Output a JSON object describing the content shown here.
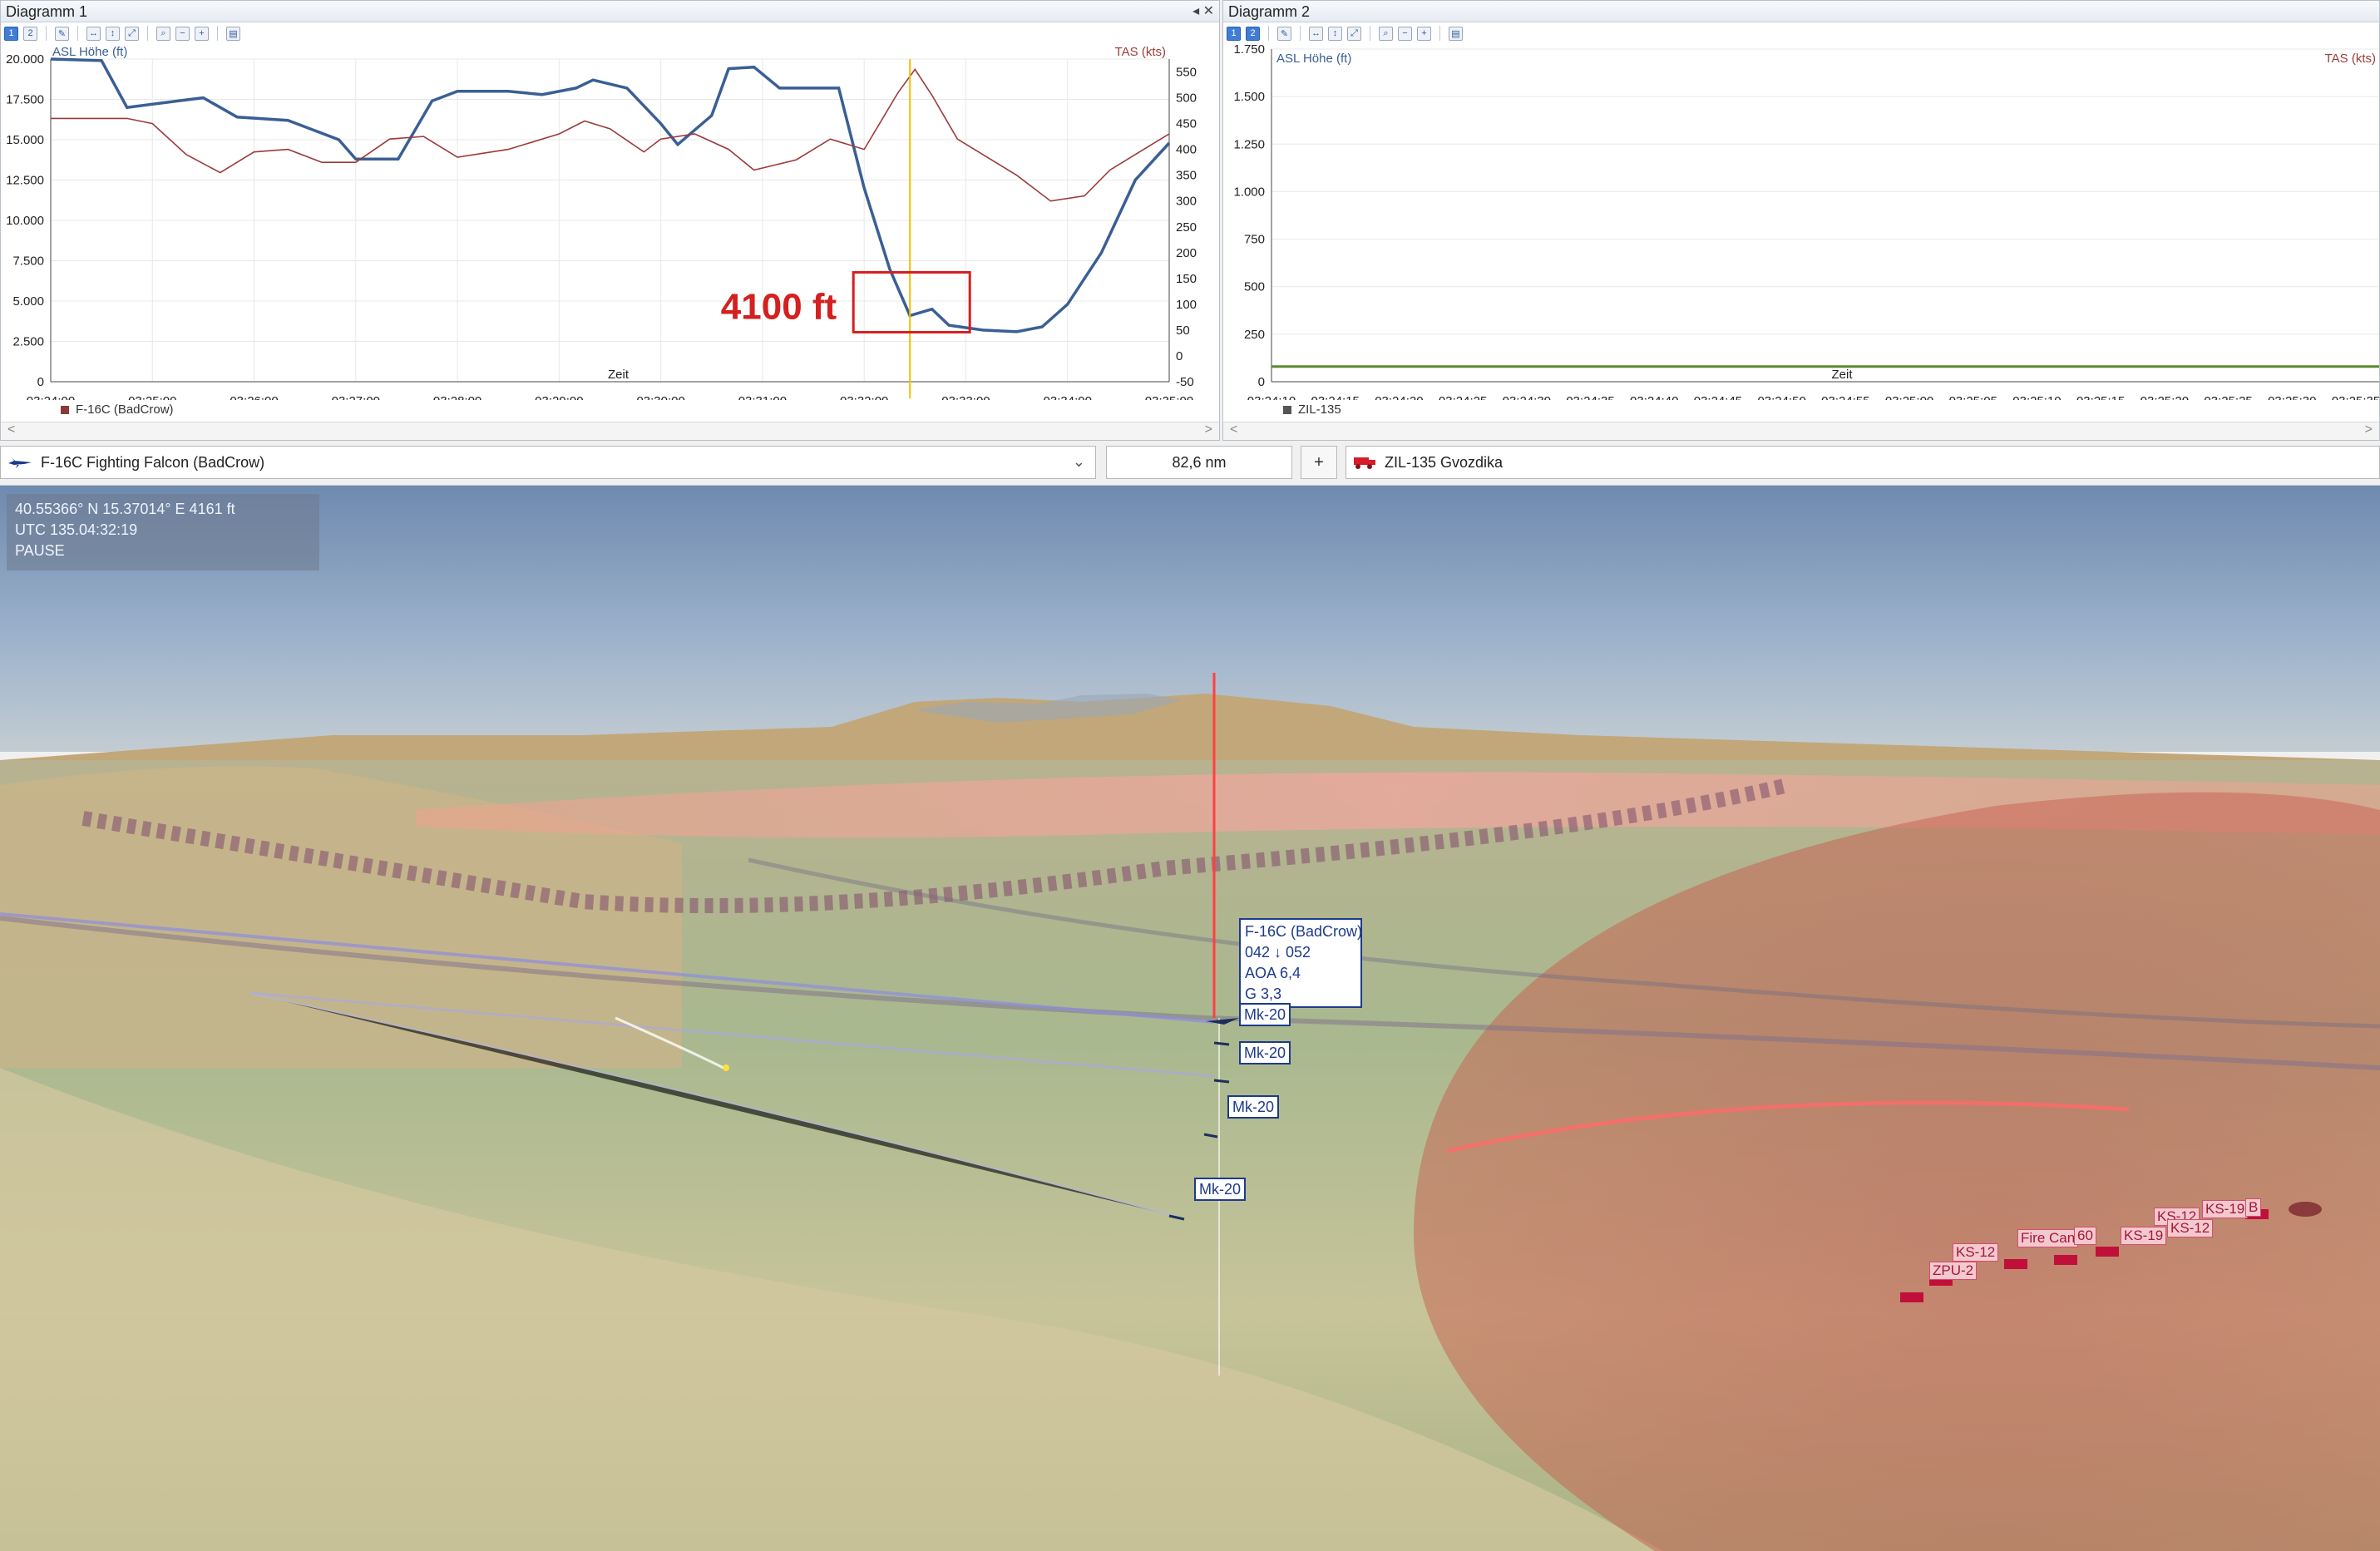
{
  "diagram1": {
    "title": "Diagramm 1",
    "controls": "◂ ✕",
    "left_axis_label": "ASL Höhe (ft)",
    "right_axis_label": "TAS (kts)",
    "x_axis_label": "Zeit",
    "legend": "F-16C (BadCrow)",
    "annotation": "4100 ft",
    "scroll_left": "<",
    "scroll_right": ">"
  },
  "diagram2": {
    "title": "Diagramm 2",
    "left_axis_label": "ASL Höhe (ft)",
    "right_axis_label": "TAS (kts)",
    "x_axis_label": "Zeit",
    "legend": "ZIL-135",
    "scroll_left": "<",
    "scroll_right": ">"
  },
  "chart_data": [
    {
      "type": "line",
      "x": [
        "03:24:00",
        "03:25:00",
        "03:26:00",
        "03:27:00",
        "03:28:00",
        "03:29:00",
        "03:30:00",
        "03:31:00",
        "03:32:00",
        "03:33:00",
        "03:34:00",
        "03:35:00"
      ],
      "ylim": [
        0,
        20000
      ],
      "y2lim": [
        -50,
        575
      ],
      "yticks": [
        "0",
        "2.500",
        "5.000",
        "7.500",
        "10.000",
        "12.500",
        "15.000",
        "17.500",
        "20.000"
      ],
      "y2ticks": [
        "-50",
        "0",
        "50",
        "100",
        "150",
        "200",
        "250",
        "300",
        "350",
        "400",
        "450",
        "500",
        "550"
      ],
      "cursor": "03:32:27",
      "series": [
        {
          "name": "ASL Höhe (ft)",
          "axis": "left",
          "color": "#3a5f95",
          "points": [
            [
              "03:24:00",
              20000
            ],
            [
              "03:24:30",
              19900
            ],
            [
              "03:24:45",
              17000
            ],
            [
              "03:25:15",
              17400
            ],
            [
              "03:25:30",
              17600
            ],
            [
              "03:25:50",
              16400
            ],
            [
              "03:26:20",
              16200
            ],
            [
              "03:26:50",
              15000
            ],
            [
              "03:27:00",
              13800
            ],
            [
              "03:27:25",
              13800
            ],
            [
              "03:27:45",
              17400
            ],
            [
              "03:28:00",
              18000
            ],
            [
              "03:28:30",
              18000
            ],
            [
              "03:28:50",
              17800
            ],
            [
              "03:29:10",
              18200
            ],
            [
              "03:29:20",
              18700
            ],
            [
              "03:29:40",
              18200
            ],
            [
              "03:30:00",
              16000
            ],
            [
              "03:30:10",
              14700
            ],
            [
              "03:30:30",
              16500
            ],
            [
              "03:30:40",
              19400
            ],
            [
              "03:30:55",
              19500
            ],
            [
              "03:31:10",
              18200
            ],
            [
              "03:31:45",
              18200
            ],
            [
              "03:32:00",
              12000
            ],
            [
              "03:32:15",
              7000
            ],
            [
              "03:32:27",
              4100
            ],
            [
              "03:32:40",
              4500
            ],
            [
              "03:32:50",
              3500
            ],
            [
              "03:33:10",
              3200
            ],
            [
              "03:33:30",
              3100
            ],
            [
              "03:33:45",
              3400
            ],
            [
              "03:34:00",
              4800
            ],
            [
              "03:34:20",
              8000
            ],
            [
              "03:34:40",
              12500
            ],
            [
              "03:35:00",
              14800
            ]
          ]
        },
        {
          "name": "TAS (kts)",
          "axis": "right",
          "color": "#9b3b3b",
          "points": [
            [
              "03:24:00",
              460
            ],
            [
              "03:24:45",
              460
            ],
            [
              "03:25:00",
              450
            ],
            [
              "03:25:20",
              390
            ],
            [
              "03:25:40",
              355
            ],
            [
              "03:26:00",
              395
            ],
            [
              "03:26:20",
              400
            ],
            [
              "03:26:40",
              375
            ],
            [
              "03:27:00",
              375
            ],
            [
              "03:27:20",
              420
            ],
            [
              "03:27:40",
              425
            ],
            [
              "03:28:00",
              385
            ],
            [
              "03:28:30",
              400
            ],
            [
              "03:29:00",
              430
            ],
            [
              "03:29:15",
              455
            ],
            [
              "03:29:30",
              440
            ],
            [
              "03:29:50",
              395
            ],
            [
              "03:30:00",
              420
            ],
            [
              "03:30:20",
              430
            ],
            [
              "03:30:40",
              400
            ],
            [
              "03:30:55",
              360
            ],
            [
              "03:31:20",
              380
            ],
            [
              "03:31:40",
              420
            ],
            [
              "03:32:00",
              400
            ],
            [
              "03:32:20",
              510
            ],
            [
              "03:32:30",
              555
            ],
            [
              "03:32:40",
              505
            ],
            [
              "03:32:55",
              420
            ],
            [
              "03:33:30",
              350
            ],
            [
              "03:33:50",
              300
            ],
            [
              "03:34:10",
              310
            ],
            [
              "03:34:25",
              360
            ],
            [
              "03:34:45",
              400
            ],
            [
              "03:35:00",
              430
            ]
          ]
        }
      ]
    },
    {
      "type": "line",
      "x": [
        "03:24:10",
        "03:24:15",
        "03:24:20",
        "03:24:25",
        "03:24:30",
        "03:24:35",
        "03:24:40",
        "03:24:45",
        "03:24:50",
        "03:24:55",
        "03:25:00",
        "03:25:05",
        "03:25:10",
        "03:25:15",
        "03:25:20",
        "03:25:25",
        "03:25:30",
        "03:25:35"
      ],
      "ylim": [
        0,
        1750
      ],
      "yticks": [
        "0",
        "250",
        "500",
        "750",
        "1.000",
        "1.250",
        "1.500",
        "1.750"
      ],
      "series": [
        {
          "name": "ZIL-135",
          "color": "#5a8a2e",
          "points": [
            [
              "03:24:10",
              80
            ],
            [
              "03:25:35",
              80
            ]
          ]
        }
      ]
    }
  ],
  "selector": {
    "aircraft": "F-16C Fighting Falcon (BadCrow)",
    "distance": "82,6 nm",
    "plus": "+",
    "target": "ZIL-135 Gvozdika",
    "chevron": "⌄"
  },
  "hud": {
    "coords": "40.55366° N  15.37014° E  4161 ft",
    "time": "UTC 135.04:32:19",
    "state": "PAUSE"
  },
  "info_tag": {
    "name": "F-16C (BadCrow)",
    "heading": "042 ↓ 052",
    "aoa": "AOA 6,4",
    "g": "G 3,3"
  },
  "weapon_tags": [
    "Mk-20",
    "Mk-20",
    "Mk-20",
    "Mk-20"
  ],
  "ground_tags": [
    "KS-12",
    "ZPU-2",
    "Fire Can",
    "60",
    "KS-19",
    "KS-12",
    "KS-19",
    "KS-12",
    "B"
  ],
  "colors": {
    "altitude_line": "#3a5f95",
    "speed_line": "#9b3b3b",
    "cursor": "#f0c000",
    "annotation": "#d42020",
    "threat_dome": "#c8504a"
  }
}
